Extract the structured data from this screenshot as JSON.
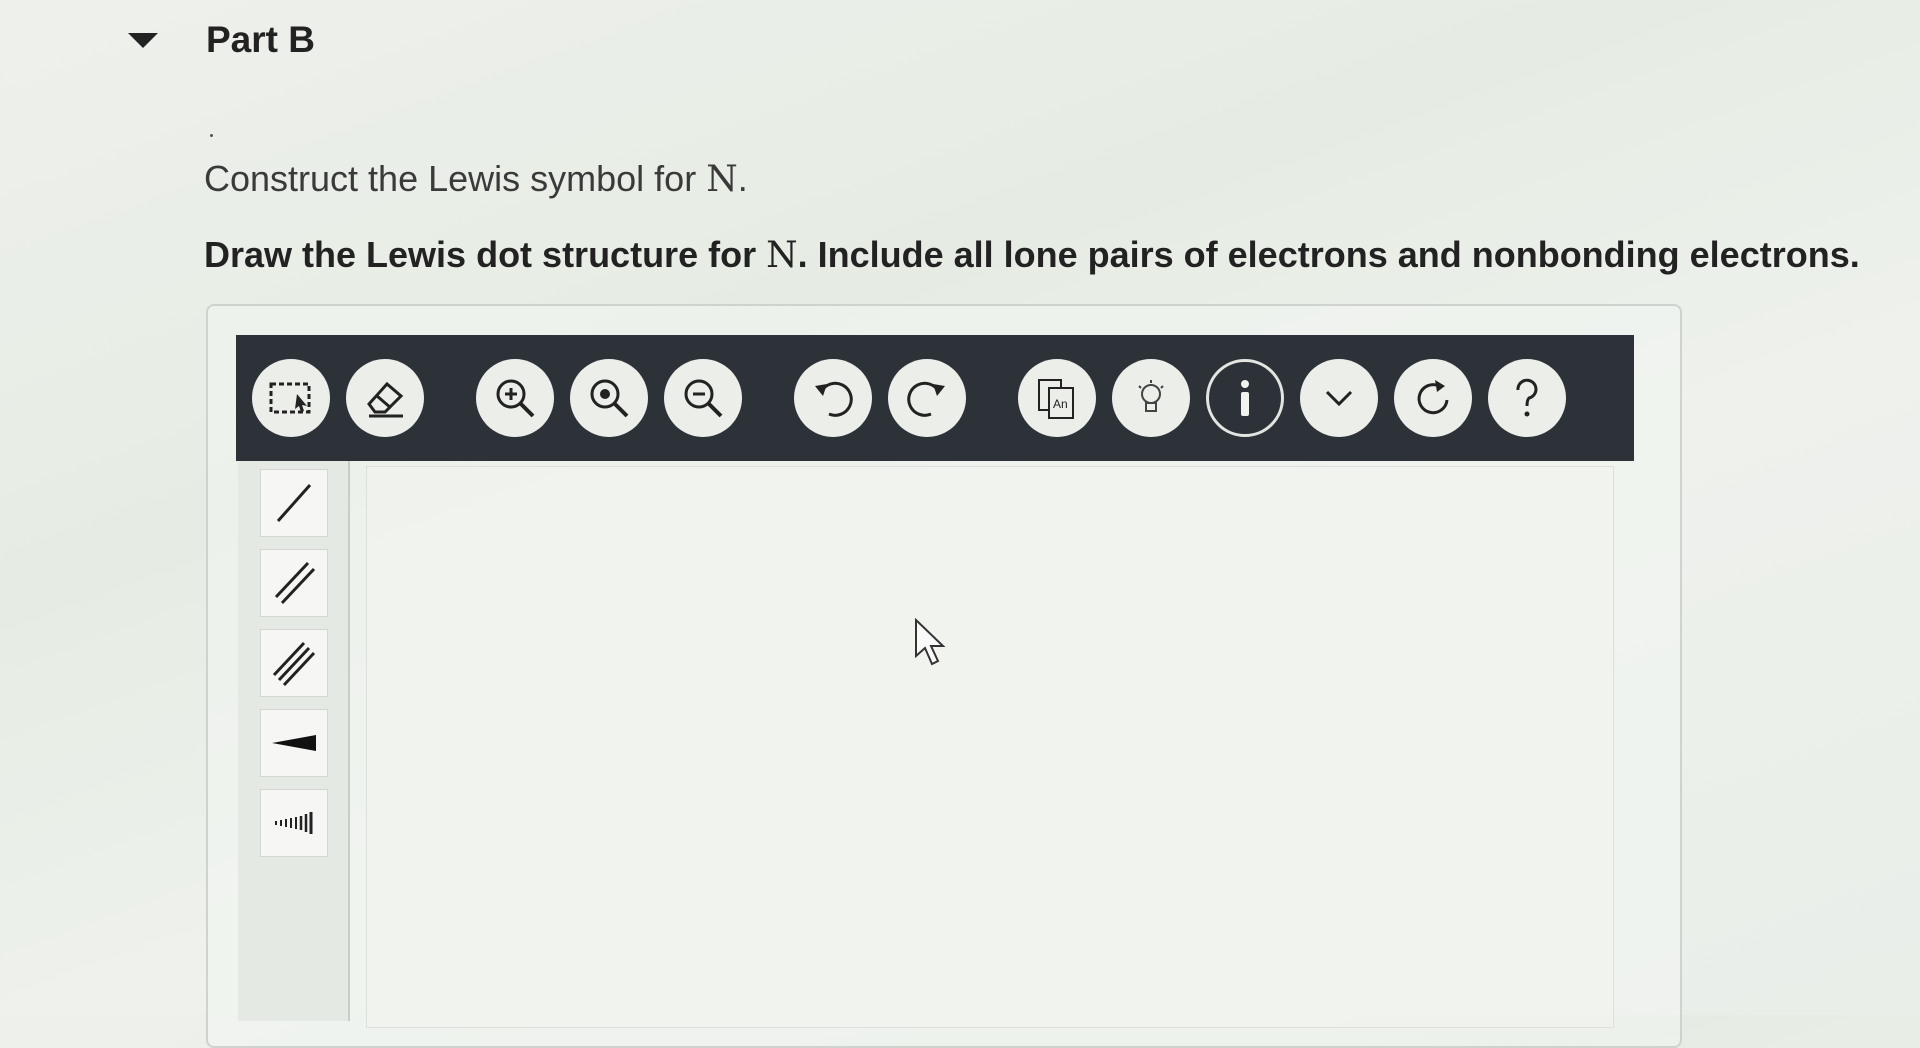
{
  "part": {
    "title": "Part B"
  },
  "question": {
    "instruction_prefix": "Construct the Lewis symbol for ",
    "element": "N",
    "instruction_suffix": ".",
    "bold_prefix": "Draw the Lewis dot structure for ",
    "bold_element": "N",
    "bold_suffix": ". Include all lone pairs of electrons and nonbonding electrons."
  },
  "toolbar": {
    "tools": [
      "select-icon",
      "eraser-icon",
      "zoom-in-icon",
      "zoom-reset-icon",
      "zoom-out-icon",
      "undo-icon",
      "redo-icon",
      "template-icon",
      "hint-icon",
      "info-icon",
      "expand-icon",
      "reset-icon",
      "help-icon"
    ],
    "template_label": "An"
  },
  "sidebar": {
    "tools": [
      "single-bond-icon",
      "double-bond-icon",
      "triple-bond-icon",
      "wedge-bond-icon",
      "hash-bond-icon"
    ]
  },
  "colors": {
    "toolbar_bg": "#2c3238",
    "button_bg": "#eceeea"
  }
}
